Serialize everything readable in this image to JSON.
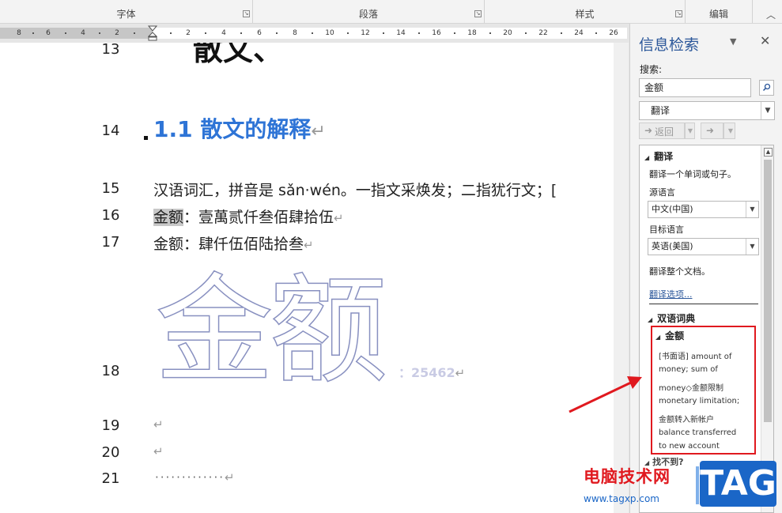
{
  "ribbon": {
    "groups": [
      "字体",
      "段落",
      "样式",
      "编辑"
    ]
  },
  "ruler": {
    "left_ticks": [
      "8",
      "6",
      "4",
      "2"
    ],
    "right_ticks": [
      "2",
      "4",
      "6",
      "8",
      "10",
      "12",
      "14",
      "16",
      "18",
      "20",
      "22",
      "24",
      "26"
    ]
  },
  "document": {
    "line_numbers": [
      "13",
      "14",
      "15",
      "16",
      "17",
      "18",
      "19",
      "20",
      "21"
    ],
    "heading_partial": "散文、",
    "heading_11": "1.1 散文的解释",
    "line15": "汉语词汇，拼音是 sǎn·wén。一指文采焕发；二指犹行文；[",
    "line16_highlight": "金额",
    "line16_rest": "：壹萬贰仟叁佰肆拾伍",
    "line17": "金额：肆仟伍佰陆拾叁",
    "big_outline": "金额",
    "outline_suffix": "：25462",
    "para_mark": "↵",
    "dots": "·············"
  },
  "pane": {
    "title": "信息检索",
    "search_label": "搜索:",
    "search_value": "金额",
    "service": "翻译",
    "back_label": "返回",
    "forward_label": "",
    "translate_section": "翻译",
    "translate_desc": "翻译一个单词或句子。",
    "source_label": "源语言",
    "source_value": "中文(中国)",
    "target_label": "目标语言",
    "target_value": "英语(美国)",
    "translate_doc": "翻译整个文档。",
    "options_link": "翻译选项...",
    "dict_section": "双语词典",
    "entry_title": "金额",
    "definition_lines": [
      "[书面语] amount of",
      "money; sum of",
      "money◇金额限制",
      "monetary limitation;",
      "金额转入新帐户",
      "balance transferred",
      "to new account"
    ],
    "not_found": "找不到?"
  },
  "watermark": {
    "site": "电脑技术网",
    "url": "www.tagxp.com",
    "tag": "TAG"
  },
  "colors": {
    "heading_blue": "#2e74d6",
    "pane_title_blue": "#2b579a",
    "highlight_red": "#e0191f"
  }
}
